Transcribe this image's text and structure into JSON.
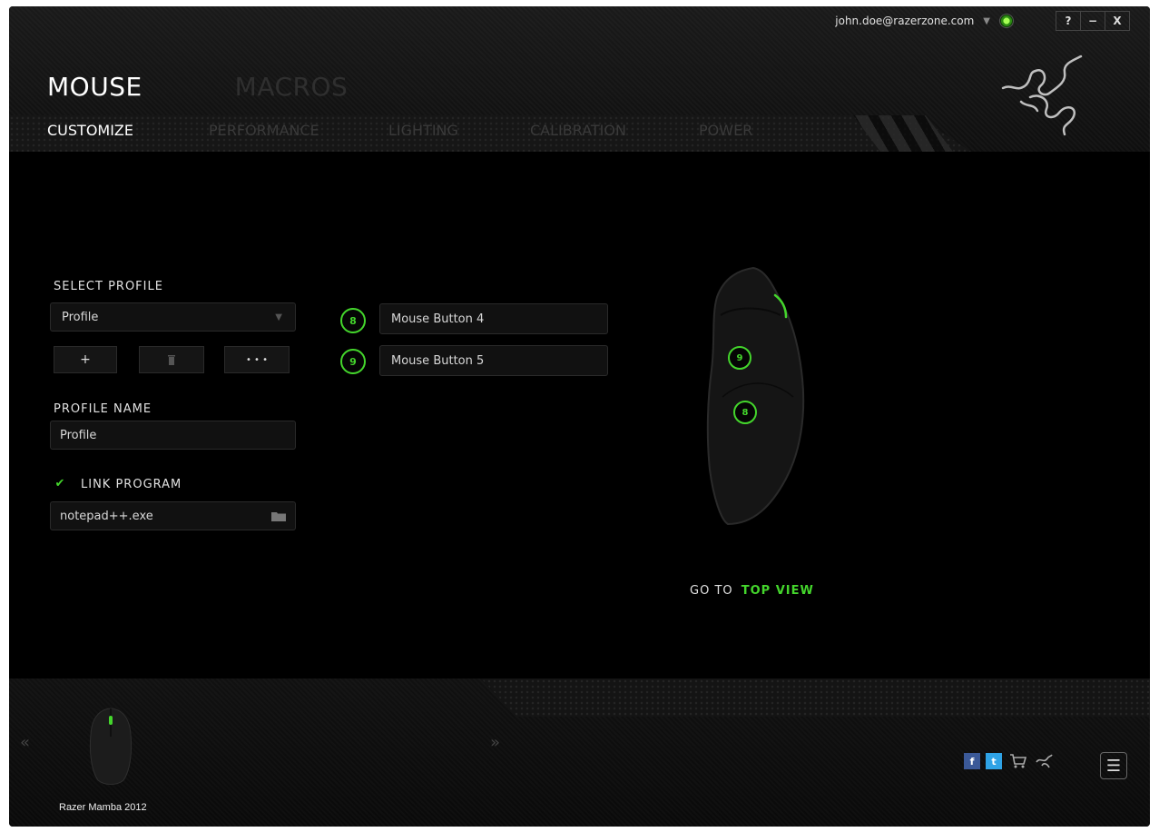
{
  "user": {
    "email": "john.doe@razerzone.com"
  },
  "window_controls": {
    "help": "?",
    "minimize": "−",
    "close": "X"
  },
  "main_tabs": [
    {
      "label": "MOUSE"
    },
    {
      "label": "MACROS"
    }
  ],
  "sub_tabs": [
    {
      "label": "CUSTOMIZE"
    },
    {
      "label": "PERFORMANCE"
    },
    {
      "label": "LIGHTING"
    },
    {
      "label": "CALIBRATION"
    },
    {
      "label": "POWER"
    }
  ],
  "profile": {
    "select_label": "SELECT PROFILE",
    "selected": "Profile",
    "add_label": "+",
    "more_label": "• • •",
    "name_label": "PROFILE NAME",
    "name_value": "Profile",
    "link_label": "LINK PROGRAM",
    "link_checked": true,
    "program": "notepad++.exe"
  },
  "buttons": [
    {
      "number": "8",
      "assignment": "Mouse Button 4"
    },
    {
      "number": "9",
      "assignment": "Mouse Button 5"
    }
  ],
  "view": {
    "goto_label": "GO TO",
    "goto_link": "TOP VIEW"
  },
  "footer": {
    "device_name": "Razer Mamba 2012",
    "prev_arrow": "«",
    "next_arrow": "»",
    "menu_glyph": "☰"
  },
  "colors": {
    "accent": "#44d62c",
    "background": "#000000"
  },
  "icons": [
    "dropdown-icon",
    "status-icon",
    "razer-logo",
    "trash-icon",
    "folder-icon",
    "checkmark-icon",
    "facebook-icon",
    "twitter-icon",
    "cart-icon",
    "razer-small-icon",
    "menu-icon"
  ]
}
